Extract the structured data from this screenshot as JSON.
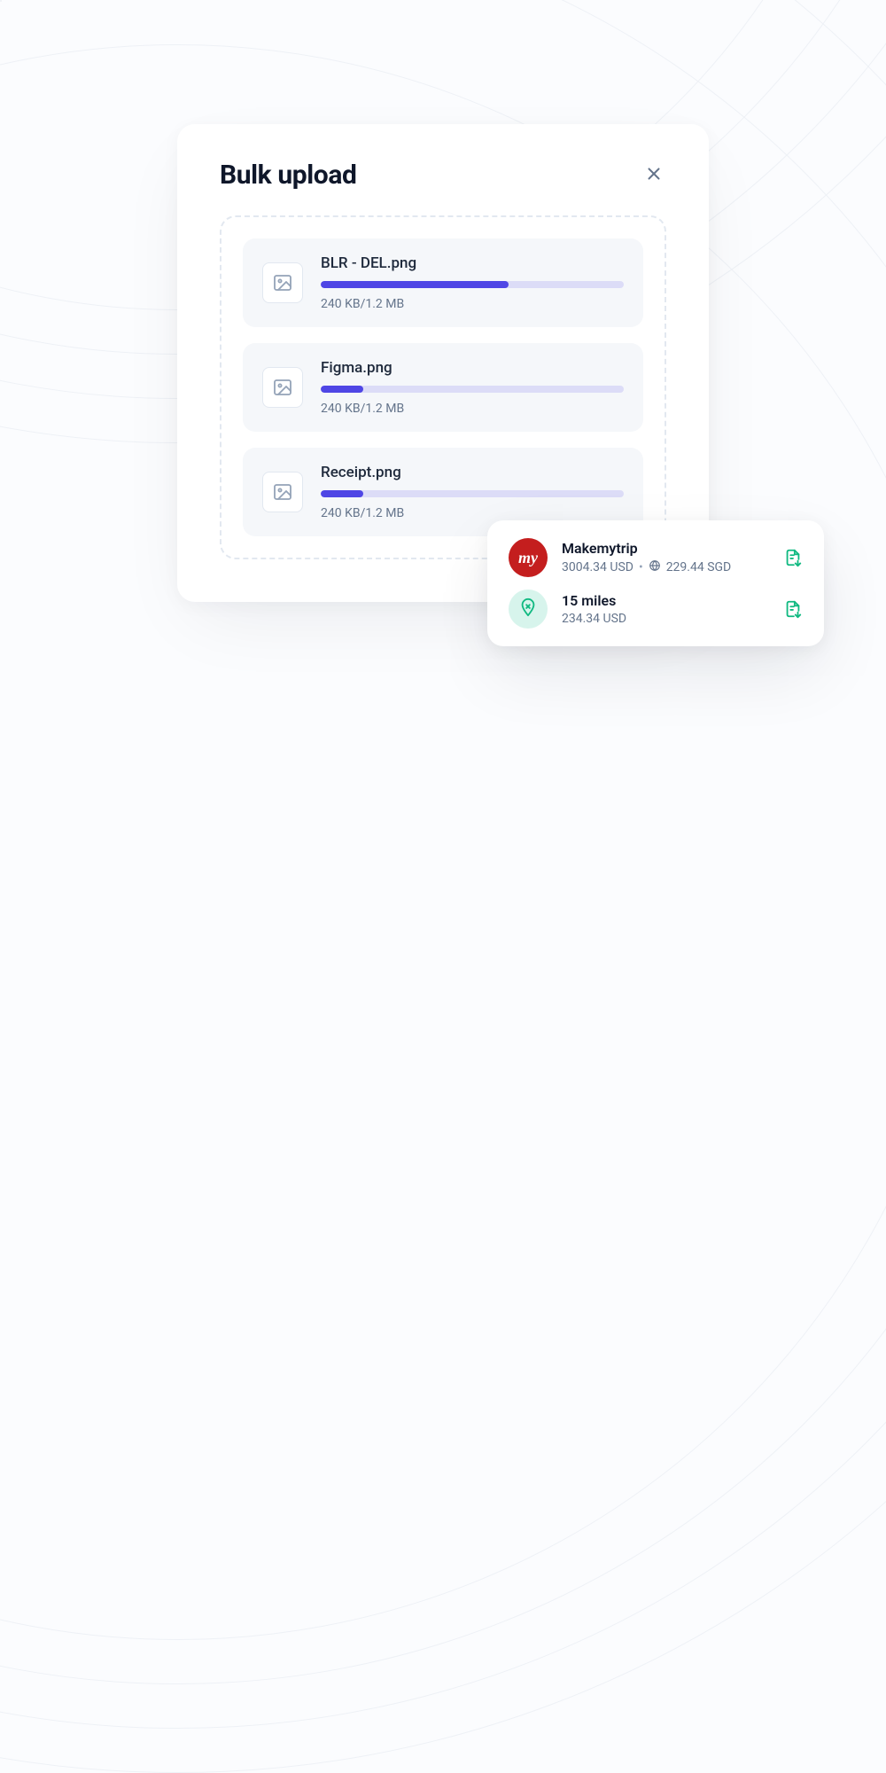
{
  "modal": {
    "title": "Bulk upload",
    "files": [
      {
        "name": "BLR - DEL.png",
        "size_text": "240 KB/1.2 MB",
        "progress_pct": 62
      },
      {
        "name": "Figma.png",
        "size_text": "240 KB/1.2 MB",
        "progress_pct": 14
      },
      {
        "name": "Receipt.png",
        "size_text": "240 KB/1.2 MB",
        "progress_pct": 14
      }
    ]
  },
  "expenses": [
    {
      "avatar_text": "my",
      "title": "Makemytrip",
      "primary_amount": "3004.34 USD",
      "secondary_amount": "229.44 SGD",
      "has_globe": true
    },
    {
      "avatar_text": "",
      "title": "15 miles",
      "primary_amount": "234.34 USD",
      "secondary_amount": "",
      "has_globe": false
    }
  ]
}
